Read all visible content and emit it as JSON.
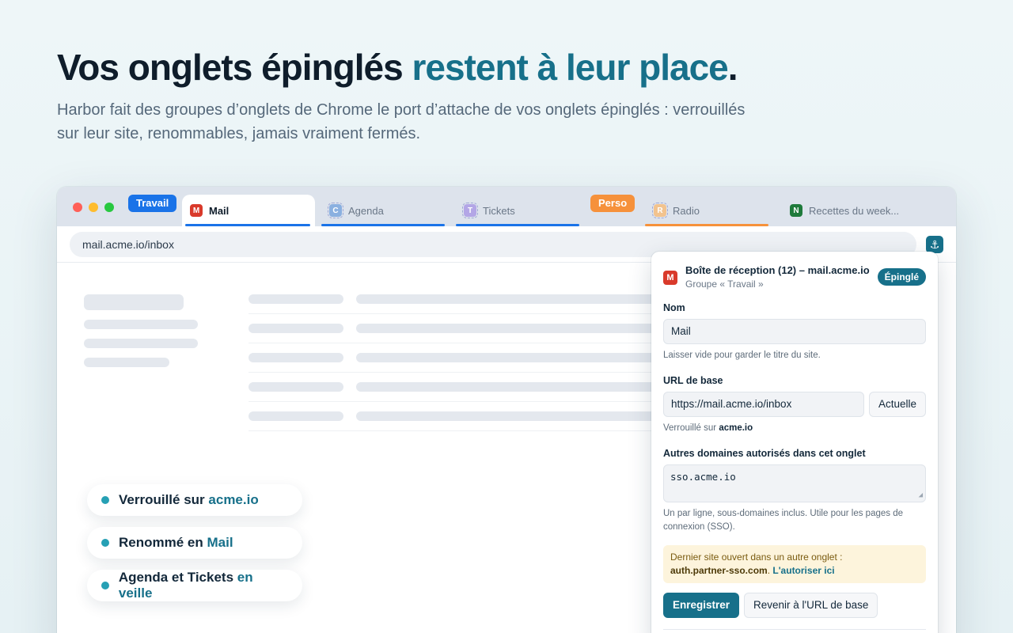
{
  "hero": {
    "title_part1": "Vos onglets épinglés",
    "title_accent": "restent à leur place",
    "title_end": ".",
    "subtitle": "Harbor fait des groupes d’onglets de Chrome le port d’attache de vos onglets épinglés : verrouillés sur leur site, renommables, jamais vraiment fermés."
  },
  "tabstrip": {
    "groups": [
      {
        "label": "Travail",
        "color": "#1a73e8"
      },
      {
        "label": "Perso",
        "color": "#f6913b"
      }
    ],
    "tabs": [
      {
        "label": "Mail",
        "favicon": "M",
        "favicon_color": "#d93a2b",
        "active": true,
        "group": "Travail"
      },
      {
        "label": "Agenda",
        "favicon": "C",
        "favicon_color": "#8ab0e0",
        "sleeping": true,
        "group": "Travail"
      },
      {
        "label": "Tickets",
        "favicon": "T",
        "favicon_color": "#b3a6e6",
        "sleeping": true,
        "group": "Travail"
      },
      {
        "label": "Radio",
        "favicon": "R",
        "favicon_color": "#f2c38e",
        "sleeping": true,
        "group": "Perso"
      },
      {
        "label": "Recettes du week...",
        "favicon": "N",
        "favicon_color": "#1e7a3b",
        "group": null
      }
    ]
  },
  "toolbar": {
    "url": "mail.acme.io/inbox",
    "extension_icon": "anchor-icon"
  },
  "bubbles": [
    {
      "text": "Verrouillé sur",
      "highlight": "acme.io"
    },
    {
      "text": "Renommé en",
      "highlight": "Mail"
    },
    {
      "text": "Agenda et Tickets",
      "highlight": "en veille"
    }
  ],
  "popup": {
    "favicon": "M",
    "title": "Boîte de réception (12) – mail.acme.io",
    "subtitle": "Groupe « Travail »",
    "badge": "Épinglé",
    "name_label": "Nom",
    "name_value": "Mail",
    "name_hint": "Laisser vide pour garder le titre du site.",
    "url_label": "URL de base",
    "url_value": "https://mail.acme.io/inbox",
    "current_button": "Actuelle",
    "lock_hint_prefix": "Verrouillé sur",
    "lock_domain": "acme.io",
    "domains_label": "Autres domaines autorisés dans cet onglet",
    "domains_value": "sso.acme.io",
    "domains_hint": "Un par ligne, sous-domaines inclus. Utile pour les pages de connexion (SSO).",
    "warning_prefix": "Dernier site ouvert dans un autre onglet :",
    "warning_domain": "auth.partner-sso.com",
    "warning_link": "L'autoriser ici",
    "save_button": "Enregistrer",
    "reset_button": "Revenir à l'URL de base"
  },
  "colors": {
    "accent": "#17708a",
    "travail": "#1a73e8",
    "perso": "#f6913b"
  }
}
